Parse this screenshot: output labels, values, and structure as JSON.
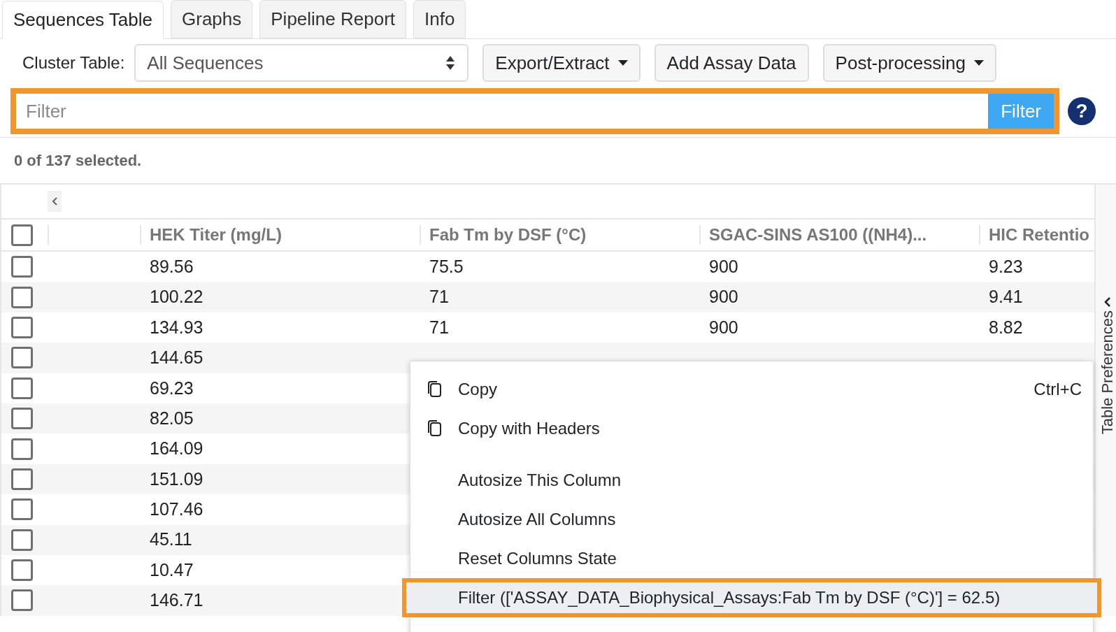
{
  "tabs": [
    {
      "label": "Sequences Table",
      "selected": true
    },
    {
      "label": "Graphs",
      "selected": false
    },
    {
      "label": "Pipeline Report",
      "selected": false
    },
    {
      "label": "Info",
      "selected": false
    }
  ],
  "toolbar": {
    "cluster_label": "Cluster Table:",
    "cluster_value": "All Sequences",
    "buttons": [
      {
        "label": "Export/Extract",
        "dropdown": true
      },
      {
        "label": "Add Assay Data",
        "dropdown": false
      },
      {
        "label": "Post-processing",
        "dropdown": true
      }
    ]
  },
  "filter": {
    "placeholder": "Filter",
    "button": "Filter",
    "highlighted": true,
    "help": "?"
  },
  "selection_status": "0 of 137 selected.",
  "table": {
    "all_checked": false,
    "columns": [
      "",
      "HEK Titer (mg/L)",
      "Fab Tm by DSF (°C)",
      "SGAC-SINS AS100 ((NH4)...",
      "HIC Retentio"
    ],
    "rows": [
      {
        "checked": false,
        "cells": [
          "",
          "89.56",
          "75.5",
          "900",
          "9.23"
        ]
      },
      {
        "checked": false,
        "cells": [
          "",
          "100.22",
          "71",
          "900",
          "9.41"
        ]
      },
      {
        "checked": false,
        "cells": [
          "",
          "134.93",
          "71",
          "900",
          "8.82"
        ]
      },
      {
        "checked": false,
        "cells": [
          "",
          "144.65"
        ]
      },
      {
        "checked": false,
        "cells": [
          "",
          "69.23"
        ]
      },
      {
        "checked": false,
        "cells": [
          "",
          "82.05"
        ]
      },
      {
        "checked": false,
        "cells": [
          "",
          "164.09"
        ]
      },
      {
        "checked": false,
        "cells": [
          "",
          "151.09"
        ]
      },
      {
        "checked": false,
        "cells": [
          "",
          "107.46"
        ]
      },
      {
        "checked": false,
        "cells": [
          "",
          "45.11"
        ]
      },
      {
        "checked": false,
        "cells": [
          "",
          "10.47"
        ]
      },
      {
        "checked": false,
        "cells": [
          "",
          "146.71"
        ]
      }
    ]
  },
  "side_panel": {
    "label": "Table Preferences"
  },
  "context_menu": [
    {
      "kind": "copy",
      "label": "Copy",
      "shortcut": "Ctrl+C",
      "highlighted": false
    },
    {
      "kind": "copy",
      "label": "Copy with Headers",
      "highlighted": false
    },
    {
      "kind": "separator"
    },
    {
      "kind": "plain",
      "label": "Autosize This Column",
      "highlighted": false
    },
    {
      "kind": "plain",
      "label": "Autosize All Columns",
      "highlighted": false
    },
    {
      "kind": "plain",
      "label": "Reset Columns State",
      "highlighted": false
    },
    {
      "kind": "plain",
      "label": "Filter (['ASSAY_DATA_Biophysical_Assays:Fab Tm by DSF (°C)'] = 62.5)",
      "highlighted": true
    }
  ]
}
